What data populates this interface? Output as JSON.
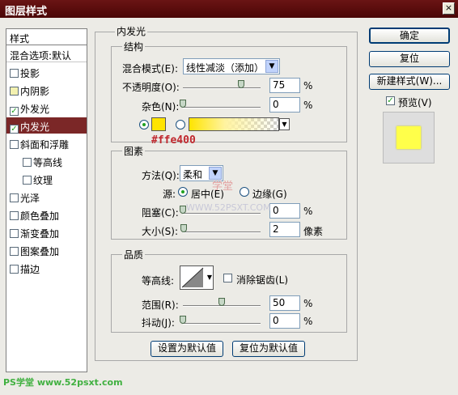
{
  "window": {
    "title": "图层样式",
    "close_label": "×"
  },
  "styles_panel": {
    "header": "样式",
    "blend_options": "混合选项:默认",
    "items": [
      {
        "label": "投影",
        "checked": false
      },
      {
        "label": "内阴影",
        "checked": false
      },
      {
        "label": "外发光",
        "checked": true
      },
      {
        "label": "内发光",
        "checked": true,
        "selected": true
      },
      {
        "label": "斜面和浮雕",
        "checked": false
      },
      {
        "label": "等高线",
        "checked": false
      },
      {
        "label": "纹理",
        "checked": false
      },
      {
        "label": "光泽",
        "checked": false
      },
      {
        "label": "颜色叠加",
        "checked": false
      },
      {
        "label": "渐变叠加",
        "checked": false
      },
      {
        "label": "图案叠加",
        "checked": false
      },
      {
        "label": "描边",
        "checked": false
      }
    ],
    "check_mark": "✓"
  },
  "inner_glow": {
    "title": "内发光",
    "structure": {
      "title": "结构",
      "blend_mode_label": "混合模式(E):",
      "blend_mode_value": "线性减淡（添加）",
      "opacity_label": "不透明度(O):",
      "opacity_value": "75",
      "opacity_fraction": 0.75,
      "noise_label": "杂色(N):",
      "noise_value": "0",
      "noise_fraction": 0,
      "percent": "%",
      "color_hex": "#ffe400",
      "color_note": "#ffe400"
    },
    "elements": {
      "title": "图素",
      "method_label": "方法(Q):",
      "method_value": "柔和",
      "source_label": "源:",
      "source_center": "居中(E)",
      "source_edge": "边缘(G)",
      "choke_label": "阻塞(C):",
      "choke_value": "0",
      "choke_fraction": 0,
      "size_label": "大小(S):",
      "size_value": "2",
      "size_fraction": 0.01,
      "percent": "%",
      "pixels": "像素"
    },
    "quality": {
      "title": "品质",
      "contour_label": "等高线:",
      "antialias_label": "消除锯齿(L)",
      "range_label": "范围(R):",
      "range_value": "50",
      "range_fraction": 0.5,
      "jitter_label": "抖动(J):",
      "jitter_value": "0",
      "jitter_fraction": 0,
      "percent": "%"
    },
    "set_default": "设置为默认值",
    "reset_default": "复位为默认值"
  },
  "actions": {
    "ok": "确定",
    "reset": "复位",
    "new_style": "新建样式(W)...",
    "preview": "预览(V)"
  },
  "watermarks": {
    "center_cn": "学堂",
    "center_url": "WWW.52PSXT.COM",
    "bottom": "PS学堂 www.52psxt.com"
  },
  "colors": {
    "accent": "#7b2727",
    "glow": "#ffe400",
    "preview": "#ffff4a"
  }
}
